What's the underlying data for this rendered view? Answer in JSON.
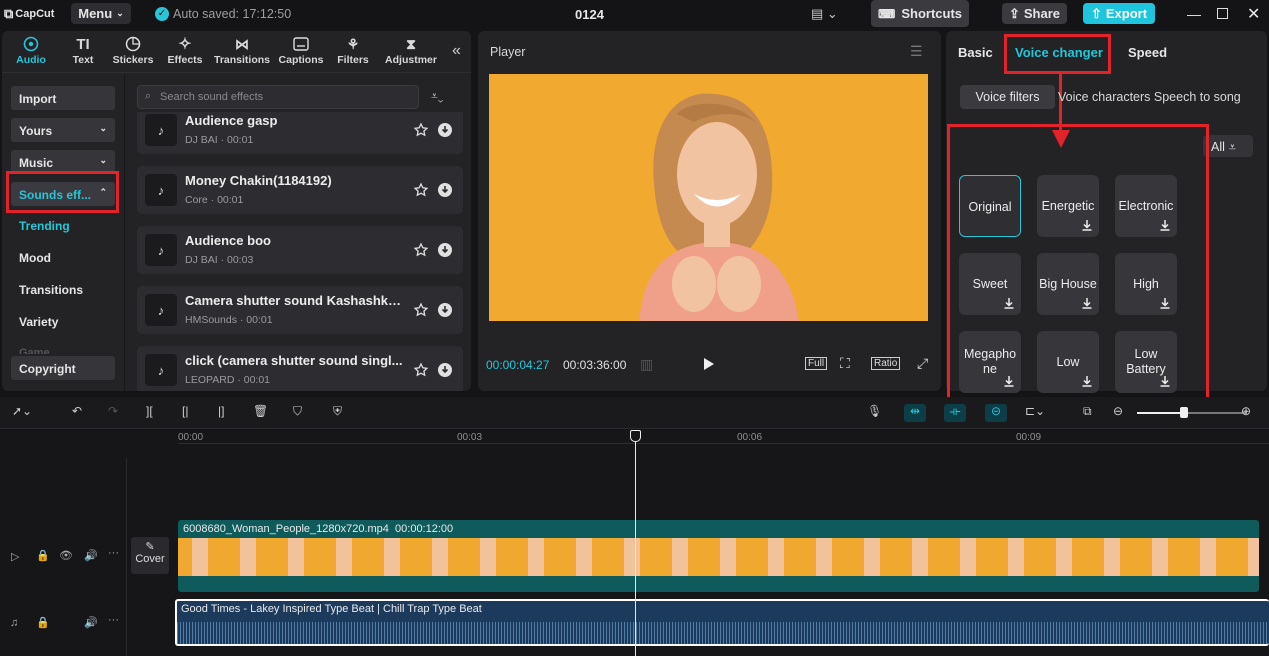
{
  "topbar": {
    "logo": "CapCut",
    "menu": "Menu",
    "autosave": "Auto saved: 17:12:50",
    "project": "0124",
    "shortcuts": "Shortcuts",
    "share": "Share",
    "export": "Export"
  },
  "tabs": [
    {
      "label": "Audio"
    },
    {
      "label": "Text"
    },
    {
      "label": "Stickers"
    },
    {
      "label": "Effects"
    },
    {
      "label": "Transitions"
    },
    {
      "label": "Captions"
    },
    {
      "label": "Filters"
    },
    {
      "label": "Adjustmer"
    }
  ],
  "leftnav": {
    "import": "Import",
    "yours": "Yours",
    "music": "Music",
    "sounds": "Sounds eff...",
    "trending": "Trending",
    "mood": "Mood",
    "transitions": "Transitions",
    "variety": "Variety",
    "game": "Game",
    "copyright": "Copyright"
  },
  "search": {
    "placeholder": "Search sound effects"
  },
  "sounds": [
    {
      "title": "Audience gasp",
      "meta": "DJ BAI · 00:01"
    },
    {
      "title": "Money Chakin(1184192)",
      "meta": "Core · 00:01"
    },
    {
      "title": "Audience boo",
      "meta": "DJ BAI · 00:03"
    },
    {
      "title": "Camera shutter sound Kashashka...",
      "meta": "HMSounds · 00:01"
    },
    {
      "title": "click (camera shutter sound singl...",
      "meta": "LEOPARD · 00:01"
    }
  ],
  "player": {
    "title": "Player",
    "current": "00:00:04:27",
    "total": "00:03:36:00",
    "full": "Full",
    "ratio": "Ratio"
  },
  "right": {
    "tab_basic": "Basic",
    "tab_voice": "Voice changer",
    "tab_speed": "Speed",
    "sub_filters": "Voice filters",
    "sub_rest": "Voice characters  Speech to song",
    "all": "All"
  },
  "voice_filters": [
    {
      "label": "Original"
    },
    {
      "label": "Energetic"
    },
    {
      "label": "Electronic"
    },
    {
      "label": "Sweet"
    },
    {
      "label": "Big House"
    },
    {
      "label": "High"
    },
    {
      "label": "Megapho ne"
    },
    {
      "label": "Low"
    },
    {
      "label": "Low Battery"
    }
  ],
  "timeline": {
    "ruler": [
      "00:00",
      "00:03",
      "00:06",
      "00:09"
    ],
    "video_clip": "6008680_Woman_People_1280x720.mp4",
    "video_dur": "00:00:12:00",
    "cover": "Cover",
    "audio1": "Good Times - Lakey Inspired Type Beat",
    "audio2": "Chill Trap Type Beat"
  },
  "colors": {
    "accent": "#26c6d8",
    "highlight": "#e3232a",
    "export": "#1fc5dd",
    "video_track": "#0f5b5b",
    "audio_track": "#1b3a5c"
  }
}
